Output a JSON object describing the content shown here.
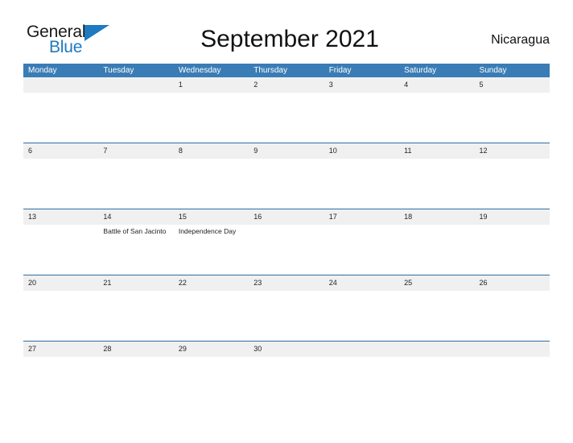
{
  "brand": {
    "name_part1": "General",
    "name_part2": "Blue",
    "flag_icon": "blue-triangle-flag-icon",
    "color_dark": "#1a1a1a",
    "color_blue": "#1f7ac0"
  },
  "header": {
    "title": "September 2021",
    "locale": "Nicaragua"
  },
  "theme": {
    "header_bar": "#3a7cb5",
    "row_divider": "#2e6da4",
    "day_band": "#f0f0f0",
    "text": "#222222",
    "page_background": "#ffffff"
  },
  "calendar": {
    "month": "September",
    "year": "2021",
    "weekday_headers": [
      "Monday",
      "Tuesday",
      "Wednesday",
      "Thursday",
      "Friday",
      "Saturday",
      "Sunday"
    ],
    "weeks": [
      {
        "days": [
          {
            "date": "",
            "events": []
          },
          {
            "date": "",
            "events": []
          },
          {
            "date": "1",
            "events": []
          },
          {
            "date": "2",
            "events": []
          },
          {
            "date": "3",
            "events": []
          },
          {
            "date": "4",
            "events": []
          },
          {
            "date": "5",
            "events": []
          }
        ]
      },
      {
        "days": [
          {
            "date": "6",
            "events": []
          },
          {
            "date": "7",
            "events": []
          },
          {
            "date": "8",
            "events": []
          },
          {
            "date": "9",
            "events": []
          },
          {
            "date": "10",
            "events": []
          },
          {
            "date": "11",
            "events": []
          },
          {
            "date": "12",
            "events": []
          }
        ]
      },
      {
        "days": [
          {
            "date": "13",
            "events": []
          },
          {
            "date": "14",
            "events": [
              "Battle of San Jacinto"
            ]
          },
          {
            "date": "15",
            "events": [
              "Independence Day"
            ]
          },
          {
            "date": "16",
            "events": []
          },
          {
            "date": "17",
            "events": []
          },
          {
            "date": "18",
            "events": []
          },
          {
            "date": "19",
            "events": []
          }
        ]
      },
      {
        "days": [
          {
            "date": "20",
            "events": []
          },
          {
            "date": "21",
            "events": []
          },
          {
            "date": "22",
            "events": []
          },
          {
            "date": "23",
            "events": []
          },
          {
            "date": "24",
            "events": []
          },
          {
            "date": "25",
            "events": []
          },
          {
            "date": "26",
            "events": []
          }
        ]
      },
      {
        "days": [
          {
            "date": "27",
            "events": []
          },
          {
            "date": "28",
            "events": []
          },
          {
            "date": "29",
            "events": []
          },
          {
            "date": "30",
            "events": []
          },
          {
            "date": "",
            "events": []
          },
          {
            "date": "",
            "events": []
          },
          {
            "date": "",
            "events": []
          }
        ]
      }
    ]
  }
}
